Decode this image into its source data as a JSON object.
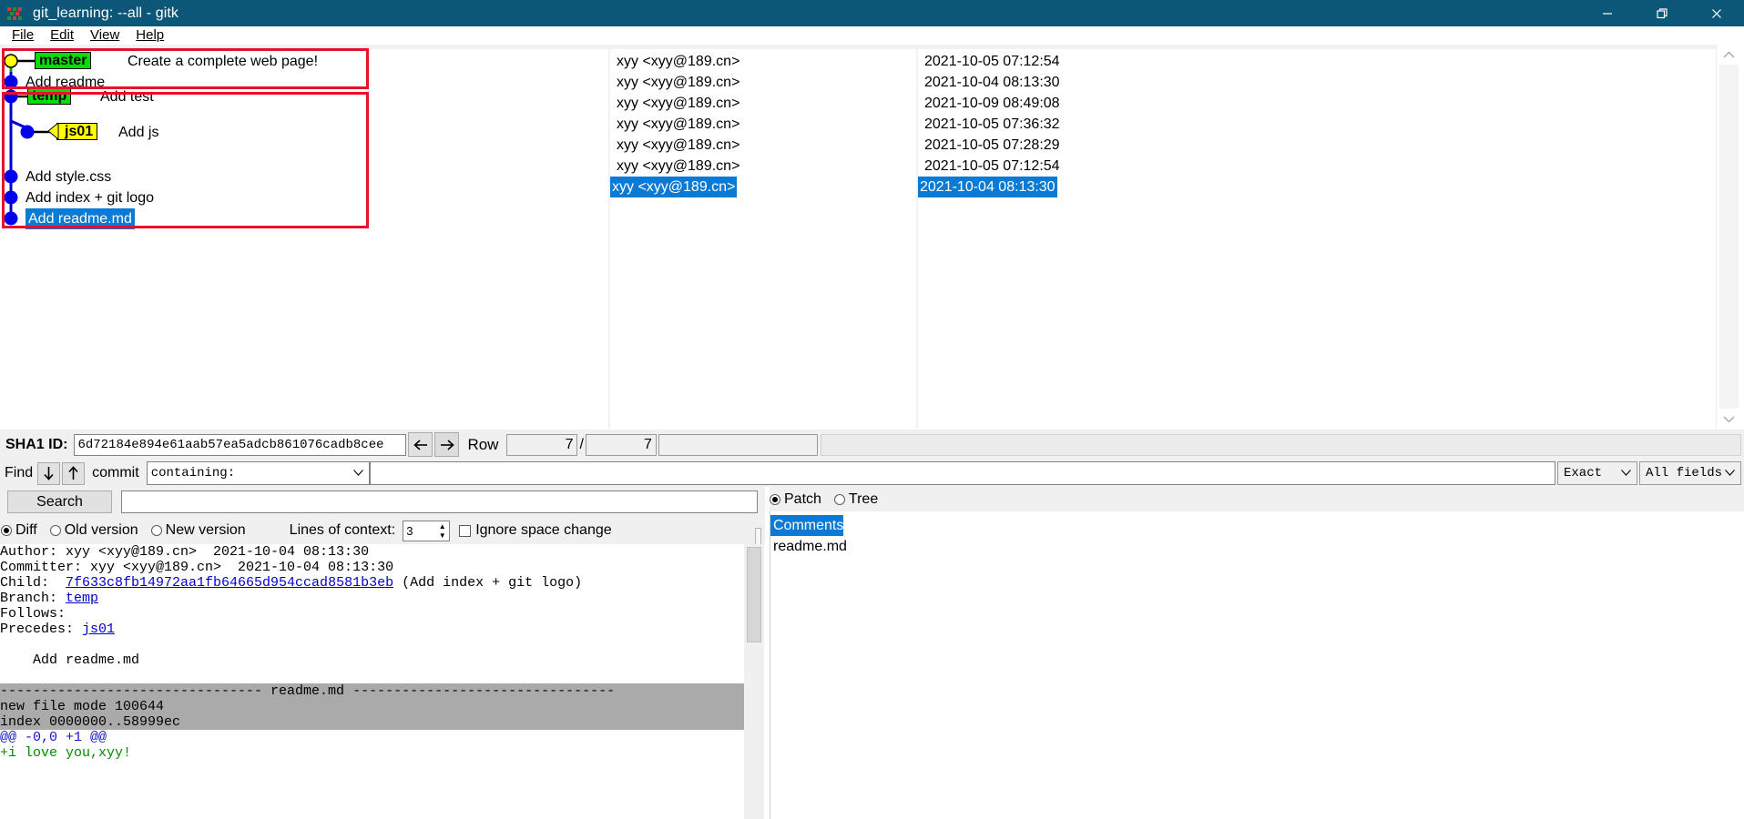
{
  "window": {
    "title": "git_learning: --all - gitk",
    "icon": "gitk-icon",
    "minimize": "minimize-icon",
    "maximize": "maximize-icon",
    "close": "close-icon"
  },
  "menubar": {
    "items": [
      {
        "label": "File"
      },
      {
        "label": "Edit"
      },
      {
        "label": "View"
      },
      {
        "label": "Help"
      }
    ]
  },
  "commit_list": {
    "rows": [
      {
        "message": "Create a complete web page!",
        "author": "xyy <xyy@189.cn>",
        "date": "2021-10-05 07:12:54",
        "ref": "master",
        "ref_type": "branch",
        "selected": false
      },
      {
        "message": "Add readme",
        "author": "xyy <xyy@189.cn>",
        "date": "2021-10-04 08:13:30",
        "ref": "",
        "ref_type": "",
        "selected": false
      },
      {
        "message": "Add test",
        "author": "xyy <xyy@189.cn>",
        "date": "2021-10-09 08:49:08",
        "ref": "temp",
        "ref_type": "branch",
        "selected": false
      },
      {
        "message": "Add js",
        "author": "xyy <xyy@189.cn>",
        "date": "2021-10-05 07:36:32",
        "ref": "js01",
        "ref_type": "tag",
        "selected": false
      },
      {
        "message": "Add style.css",
        "author": "xyy <xyy@189.cn>",
        "date": "2021-10-05 07:28:29",
        "ref": "",
        "ref_type": "",
        "selected": false
      },
      {
        "message": "Add index + git logo",
        "author": "xyy <xyy@189.cn>",
        "date": "2021-10-05 07:12:54",
        "ref": "",
        "ref_type": "",
        "selected": false
      },
      {
        "message": "Add readme.md",
        "author": "xyy <xyy@189.cn>",
        "date": "2021-10-04 08:13:30",
        "ref": "",
        "ref_type": "",
        "selected": true
      }
    ],
    "annotation_color": "#e8112d"
  },
  "sha_row": {
    "label": "SHA1 ID:",
    "value": "6d72184e894e61aab57ea5adcb861076cadb8cee",
    "back_icon": "arrow-left-icon",
    "forward_icon": "arrow-right-icon",
    "row_label": "Row",
    "row_current": "7",
    "row_separator": "/",
    "row_total": "7"
  },
  "find_row": {
    "label": "Find",
    "down_icon": "arrow-down-icon",
    "up_icon": "arrow-up-icon",
    "scope_label": "commit",
    "mode": "containing:",
    "query": "",
    "match_type": "Exact",
    "fields": "All fields"
  },
  "search_row": {
    "button": "Search",
    "value": ""
  },
  "diff_options": {
    "diff": "Diff",
    "old_version": "Old version",
    "new_version": "New version",
    "selected": "Diff",
    "context_label": "Lines of context:",
    "context_value": "3",
    "ignore_space": "Ignore space change",
    "ignore_space_checked": false
  },
  "view_mode": {
    "patch": "Patch",
    "tree": "Tree",
    "selected": "Patch"
  },
  "details": {
    "author_line": "Author: xyy <xyy@189.cn>  2021-10-04 08:13:30",
    "committer_line": "Committer: xyy <xyy@189.cn>  2021-10-04 08:13:30",
    "child_label": "Child:  ",
    "child_sha": "7f633c8fb14972aa1fb64665d954ccad8581b3eb",
    "child_msg": " (Add index + git logo)",
    "branch_label": "Branch: ",
    "branch_value": "temp",
    "follows_label": "Follows:",
    "precedes_label": "Precedes: ",
    "precedes_value": "js01",
    "commit_message": "    Add readme.md",
    "file_header": "-------------------------------- readme.md --------------------------------",
    "mode_line": "new file mode 100644",
    "index_line": "index 0000000..58999ec",
    "hunk_line": "@@ -0,0 +1 @@",
    "added_line": "+i love you,xyy!"
  },
  "file_list": {
    "items": [
      {
        "label": "Comments",
        "selected": true
      },
      {
        "label": "readme.md",
        "selected": false
      }
    ]
  }
}
